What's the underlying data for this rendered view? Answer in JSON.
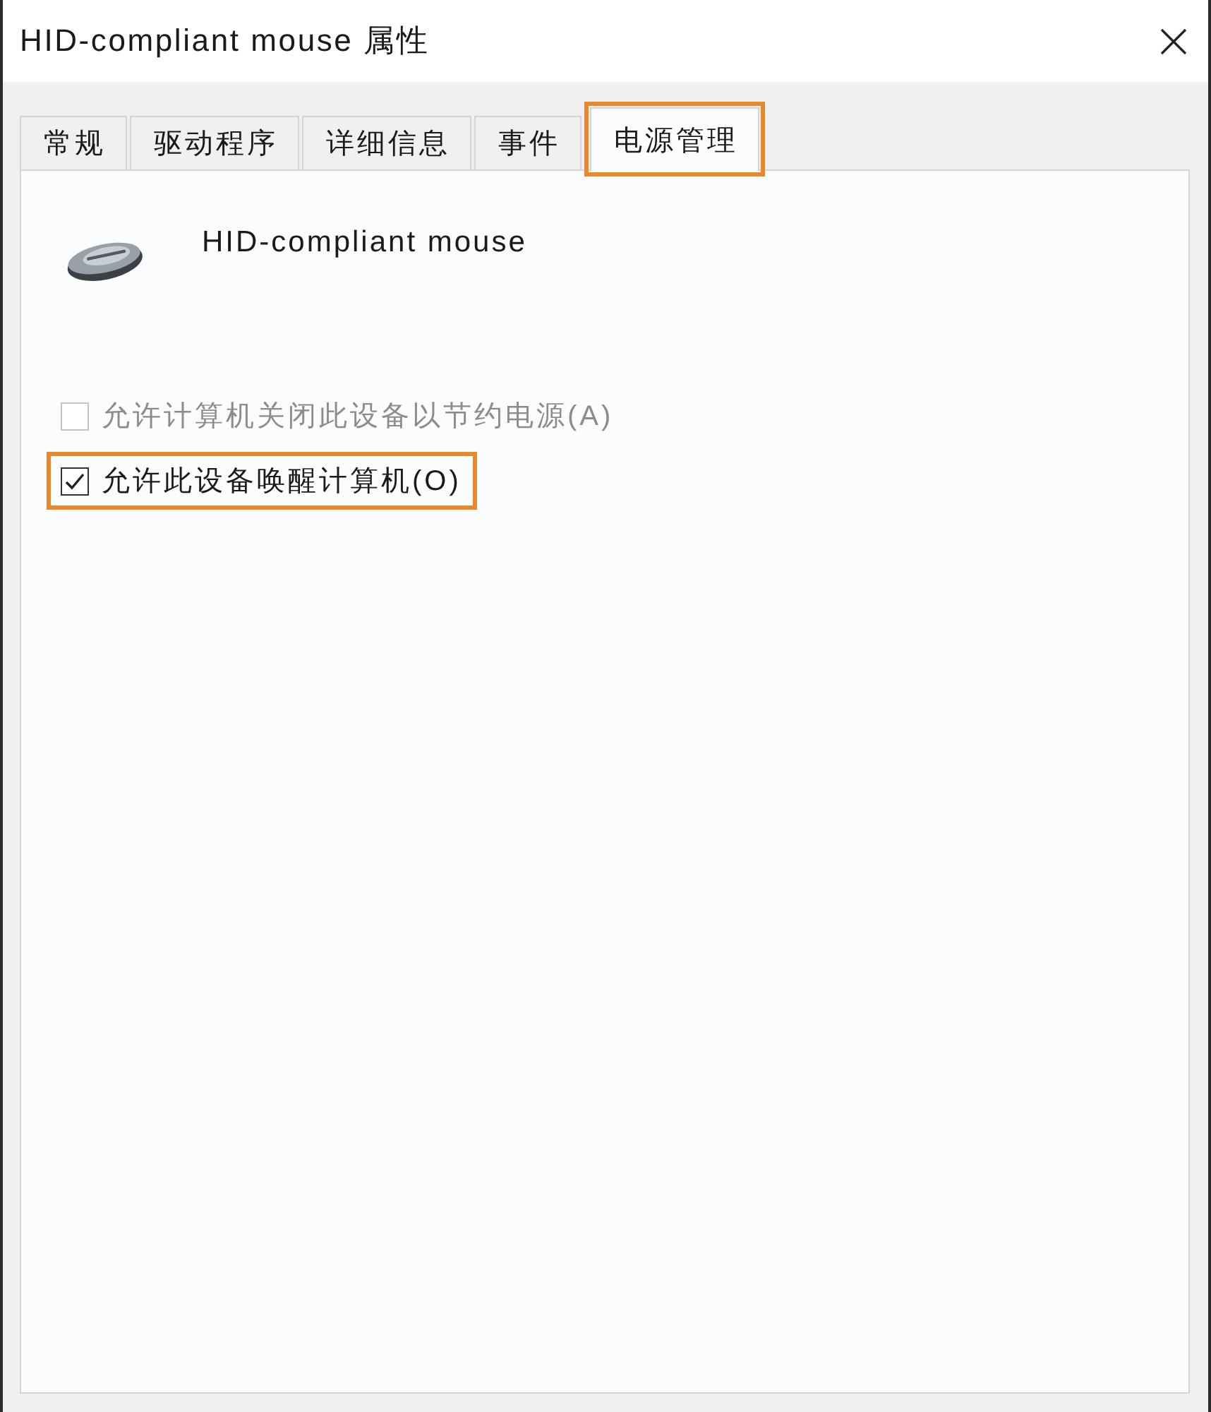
{
  "window": {
    "title": "HID-compliant mouse 属性"
  },
  "tabs": [
    {
      "label": "常规",
      "selected": false,
      "highlighted": false
    },
    {
      "label": "驱动程序",
      "selected": false,
      "highlighted": false
    },
    {
      "label": "详细信息",
      "selected": false,
      "highlighted": false
    },
    {
      "label": "事件",
      "selected": false,
      "highlighted": false
    },
    {
      "label": "电源管理",
      "selected": true,
      "highlighted": true
    }
  ],
  "device": {
    "name": "HID-compliant mouse"
  },
  "options": [
    {
      "label": "允许计算机关闭此设备以节约电源(A)",
      "checked": false,
      "disabled": true,
      "highlighted": false
    },
    {
      "label": "允许此设备唤醒计算机(O)",
      "checked": true,
      "disabled": false,
      "highlighted": true
    }
  ]
}
